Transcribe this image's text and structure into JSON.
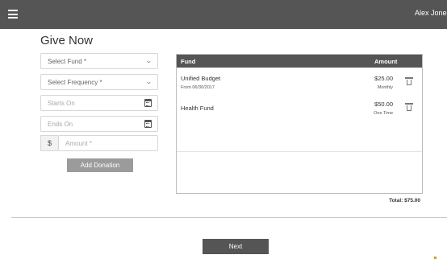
{
  "header": {
    "menu_icon": "hamburger-menu-icon",
    "user_name": "Alex Jones"
  },
  "form": {
    "title": "Give Now",
    "fund_select": {
      "placeholder": "Select Fund *"
    },
    "frequency_select": {
      "placeholder": "Select Frequency *"
    },
    "starts_on": {
      "placeholder": "Starts On",
      "icon": "calendar-icon"
    },
    "ends_on": {
      "placeholder": "Ends On",
      "icon": "calendar-icon"
    },
    "amount": {
      "currency_symbol": "$",
      "placeholder": "Amount *"
    },
    "add_donation_label": "Add Donation"
  },
  "donations": {
    "columns": {
      "fund": "Fund",
      "amount": "Amount"
    },
    "rows": [
      {
        "fund": "Unified Budget",
        "sub": "From 06/30/2017",
        "amount": "$25.00",
        "frequency": "Monthly"
      },
      {
        "fund": "Health Fund",
        "sub": "",
        "amount": "$50.00",
        "frequency": "One Time"
      }
    ],
    "total": "Total: $75.00"
  },
  "footer": {
    "next_label": "Next"
  },
  "colors": {
    "header_bg": "#555555",
    "button_gray": "#9b9b9b",
    "border": "#d6d6d6"
  }
}
